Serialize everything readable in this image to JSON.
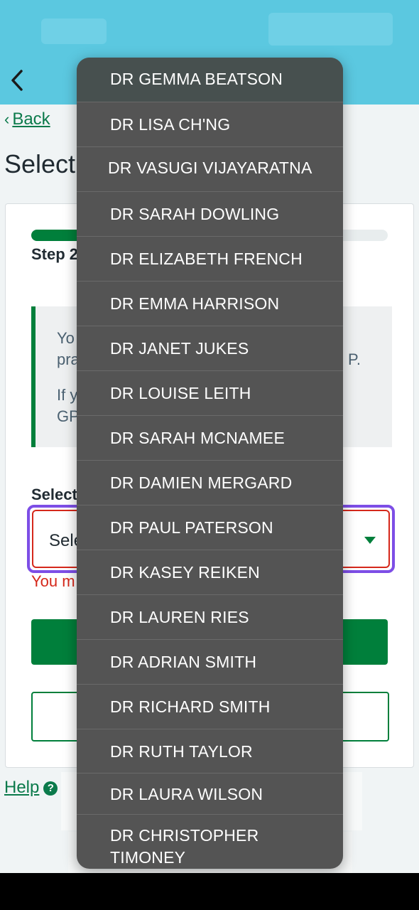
{
  "nav": {
    "back_label": "Back"
  },
  "page": {
    "title": "Select"
  },
  "form": {
    "step_text": "Step 2",
    "progress_fraction": 0.2,
    "info_line1": "Yo",
    "info_line2": "pra",
    "info_line2_end": "P.",
    "info_line3": "If y",
    "info_line4": "GP",
    "select_label": "Select",
    "select_value": "Sele",
    "error_text": "You m"
  },
  "help": {
    "label": "Help"
  },
  "dropdown": {
    "options": [
      "DR GEMMA BEATSON",
      "DR LISA CH'NG",
      "DR VASUGI VIJAYARATNA",
      "DR SARAH DOWLING",
      "DR ELIZABETH FRENCH",
      "DR EMMA HARRISON",
      "DR JANET JUKES",
      "DR LOUISE LEITH",
      "DR SARAH MCNAMEE",
      "DR DAMIEN MERGARD",
      "DR PAUL PATERSON",
      "DR KASEY REIKEN",
      "DR LAUREN RIES",
      "DR ADRIAN SMITH",
      "DR RICHARD SMITH",
      "DR RUTH TAYLOR",
      "DR LAURA WILSON",
      "DR CHRISTOPHER TIMONEY"
    ]
  },
  "colors": {
    "nhs_green": "#007f3b",
    "error_red": "#d5281b",
    "focus_purple": "#7d4ee6",
    "header_blue": "#5bc8e0",
    "dropdown_bg": "#545454"
  }
}
